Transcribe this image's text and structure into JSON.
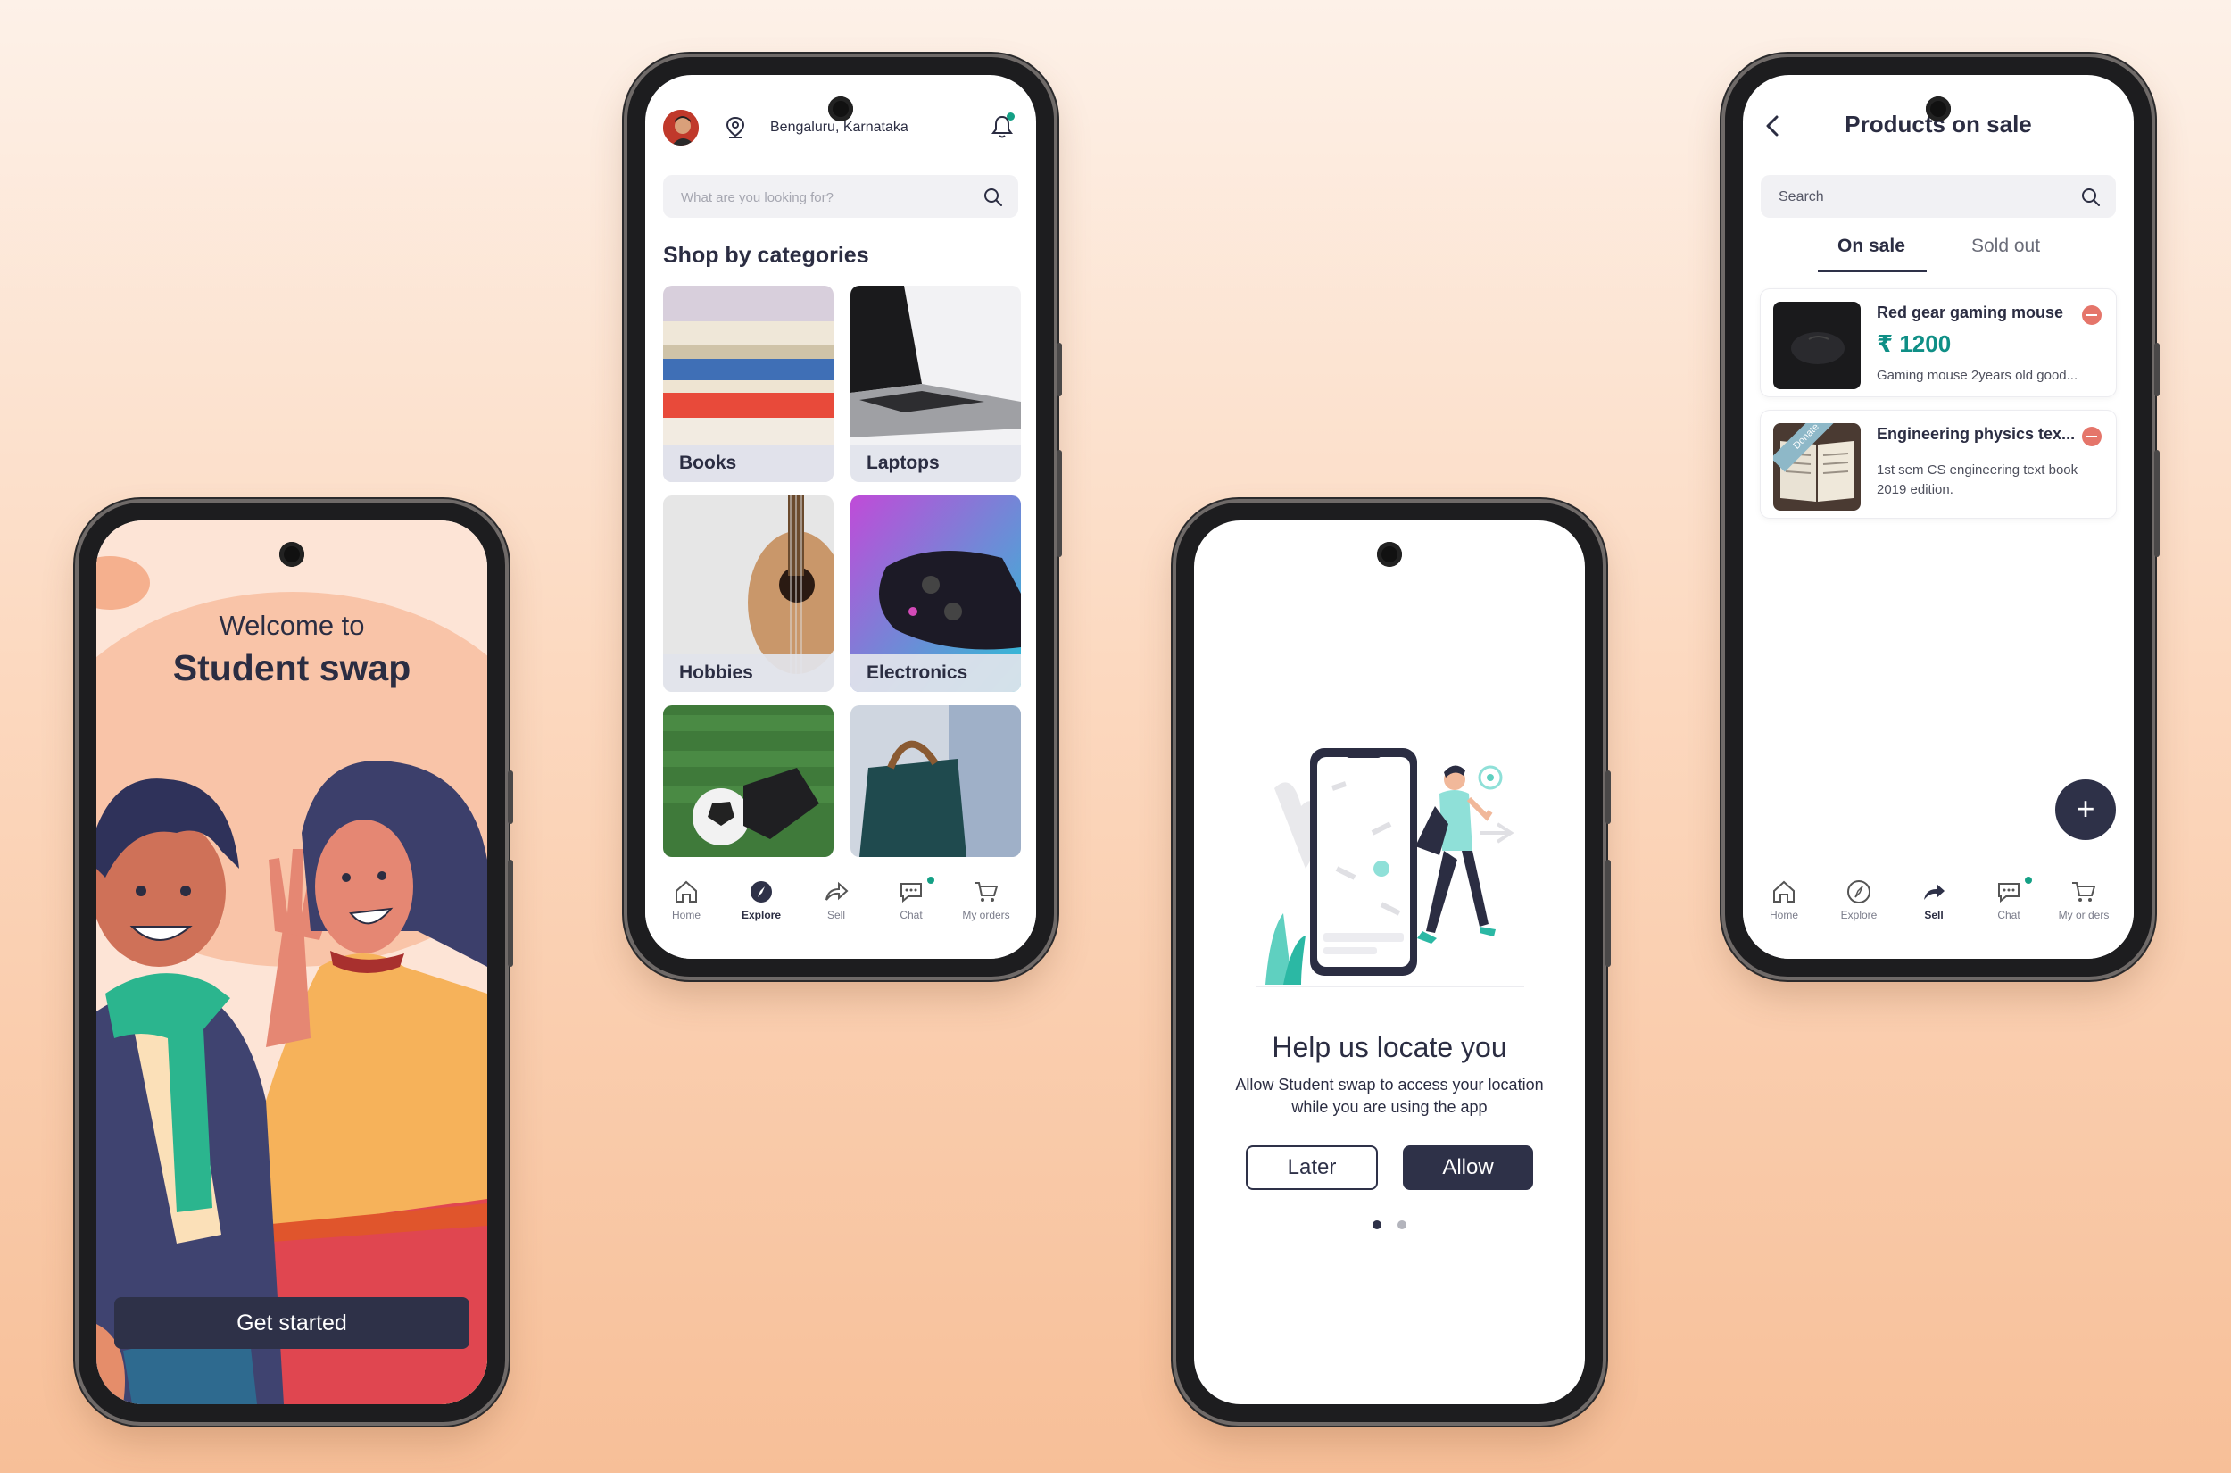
{
  "welcome": {
    "line1": "Welcome to",
    "line2": "Student swap",
    "cta": "Get started"
  },
  "explore": {
    "location": "Bengaluru, Karnataka",
    "search_placeholder": "What are you looking for?",
    "section_title": "Shop by categories",
    "categories": [
      {
        "label": "Books"
      },
      {
        "label": "Laptops"
      },
      {
        "label": "Hobbies"
      },
      {
        "label": "Electronics"
      },
      {
        "label": ""
      },
      {
        "label": ""
      }
    ],
    "nav": [
      {
        "label": "Home",
        "icon": "home-icon"
      },
      {
        "label": "Explore",
        "icon": "compass-icon"
      },
      {
        "label": "Sell",
        "icon": "share-arrow-icon"
      },
      {
        "label": "Chat",
        "icon": "chat-icon"
      },
      {
        "label": "My orders",
        "icon": "cart-icon"
      }
    ],
    "active_nav": "Explore"
  },
  "locate": {
    "title": "Help us locate you",
    "description": "Allow Student swap to access your location while you are using the app",
    "later": "Later",
    "allow": "Allow",
    "pages": 2,
    "current_page": 1
  },
  "sale": {
    "title": "Products on sale",
    "search_placeholder": "Search",
    "tabs": [
      {
        "label": "On sale"
      },
      {
        "label": "Sold out"
      }
    ],
    "active_tab": "On sale",
    "products": [
      {
        "name": "Red gear gaming mouse",
        "price": "₹ 1200",
        "description": "Gaming mouse 2years old good..."
      },
      {
        "name": "Engineering physics tex...",
        "ribbon": "Donate",
        "description": "1st sem CS engineering  text book 2019 edition."
      }
    ],
    "fab": "+",
    "nav": [
      {
        "label": "Home",
        "icon": "home-icon"
      },
      {
        "label": "Explore",
        "icon": "compass-icon"
      },
      {
        "label": "Sell",
        "icon": "share-arrow-icon"
      },
      {
        "label": "Chat",
        "icon": "chat-icon"
      },
      {
        "label": "My or ders",
        "icon": "cart-icon"
      }
    ],
    "active_nav": "Sell"
  },
  "colors": {
    "primary": "#2e3148",
    "accent_teal": "#14a085",
    "price": "#0f8f86",
    "remove": "#e5756a",
    "background_top": "#fdf1e8",
    "background_bottom": "#f7bf98"
  }
}
